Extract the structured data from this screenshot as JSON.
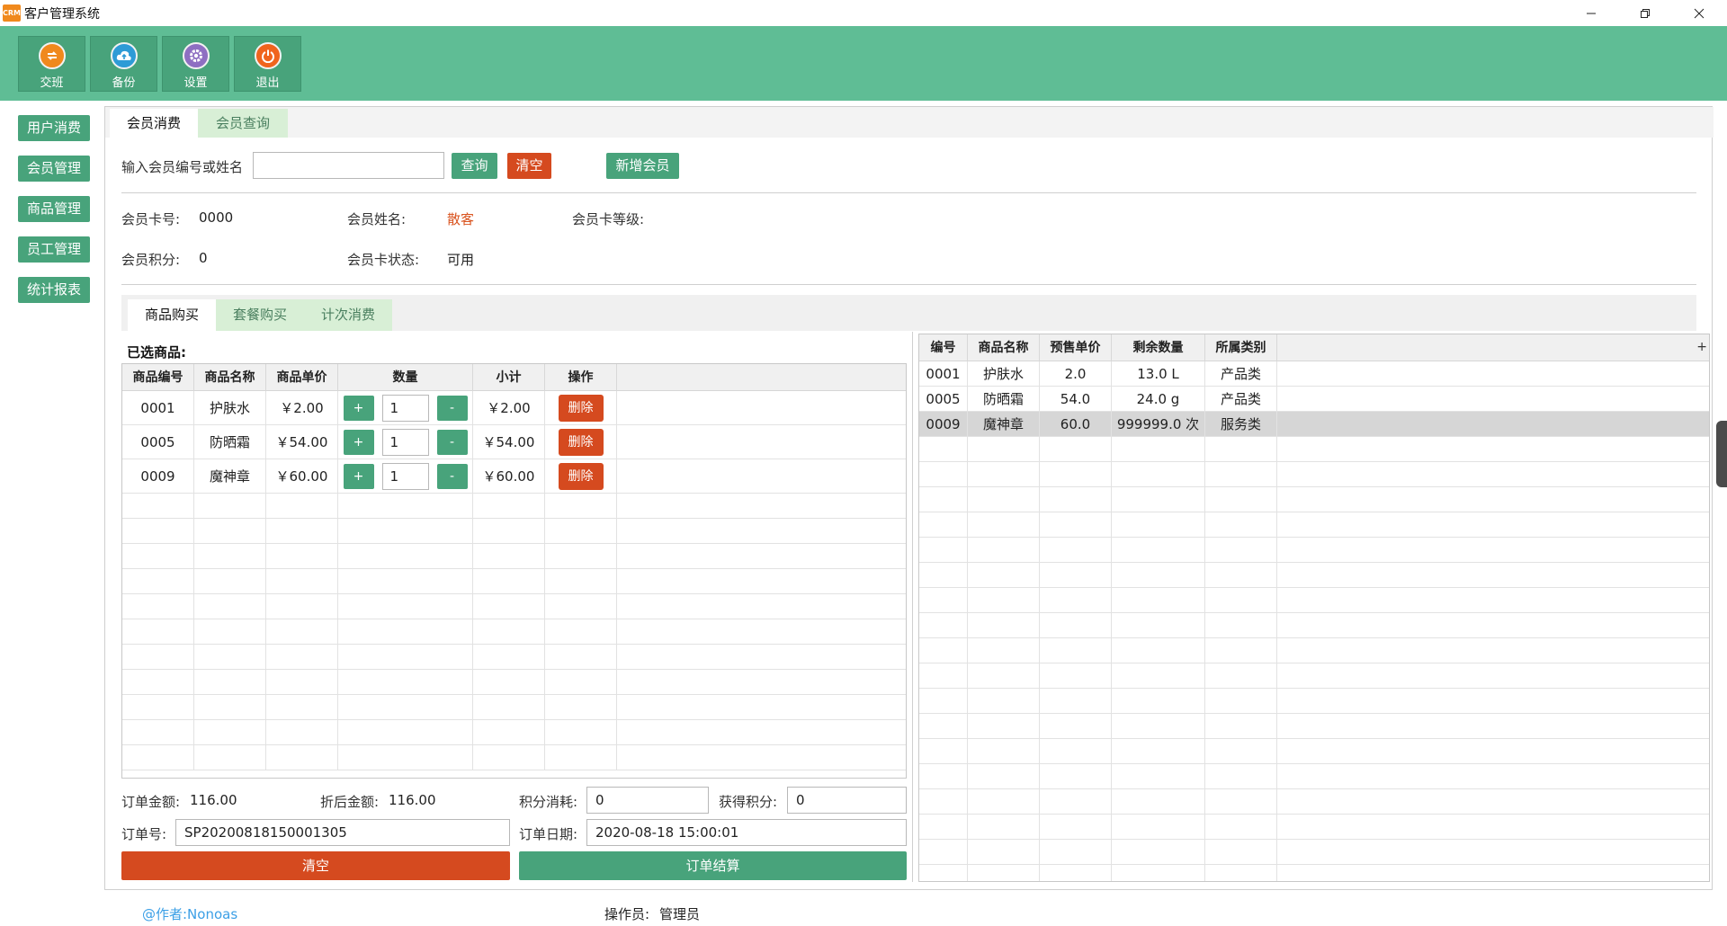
{
  "window": {
    "app_icon_text": "CRM",
    "title": "客户管理系统"
  },
  "toolbar": [
    {
      "label": "交班",
      "icon": "handover-icon",
      "color": "#f0891d"
    },
    {
      "label": "备份",
      "icon": "cloud-upload-icon",
      "color": "#2e9bd6"
    },
    {
      "label": "设置",
      "icon": "gear-icon",
      "color": "#8e6fc2"
    },
    {
      "label": "退出",
      "icon": "power-icon",
      "color": "#f0641d"
    }
  ],
  "sidebar": [
    "用户消费",
    "会员管理",
    "商品管理",
    "员工管理",
    "统计报表"
  ],
  "main_tabs": {
    "consume": "会员消费",
    "query": "会员查询"
  },
  "search": {
    "label": "输入会员编号或姓名",
    "value": "",
    "query_btn": "查询",
    "clear_btn": "清空",
    "add_member_btn": "新增会员"
  },
  "member": {
    "card_no_label": "会员卡号:",
    "card_no": "0000",
    "name_label": "会员姓名:",
    "name": "散客",
    "level_label": "会员卡等级:",
    "level": "",
    "points_label": "会员积分:",
    "points": "0",
    "status_label": "会员卡状态:",
    "status": "可用"
  },
  "sub_tabs": {
    "goods": "商品购买",
    "package": "套餐购买",
    "times": "计次消费"
  },
  "selected_title": "已选商品:",
  "cart": {
    "headers": [
      "商品编号",
      "商品名称",
      "商品单价",
      "数量",
      "小计",
      "操作"
    ],
    "plus": "+",
    "minus": "-",
    "delete": "删除",
    "rows": [
      {
        "code": "0001",
        "name": "护肤水",
        "price": "￥2.00",
        "qty": "1",
        "subtotal": "￥2.00"
      },
      {
        "code": "0005",
        "name": "防晒霜",
        "price": "￥54.00",
        "qty": "1",
        "subtotal": "￥54.00"
      },
      {
        "code": "0009",
        "name": "魔神章",
        "price": "￥60.00",
        "qty": "1",
        "subtotal": "￥60.00"
      }
    ]
  },
  "products": {
    "headers": [
      "编号",
      "商品名称",
      "预售单价",
      "剩余数量",
      "所属类别"
    ],
    "rows": [
      {
        "code": "0001",
        "name": "护肤水",
        "price": "2.0",
        "stock": "13.0 L",
        "category": "产品类"
      },
      {
        "code": "0005",
        "name": "防晒霜",
        "price": "54.0",
        "stock": "24.0 g",
        "category": "产品类"
      },
      {
        "code": "0009",
        "name": "魔神章",
        "price": "60.0",
        "stock": "999999.0 次",
        "category": "服务类"
      }
    ]
  },
  "order": {
    "amount_label": "订单金额:",
    "amount": "116.00",
    "discount_label": "折后金额:",
    "discount": "116.00",
    "points_use_label": "积分消耗:",
    "points_use": "0",
    "points_gain_label": "获得积分:",
    "points_gain": "0",
    "no_label": "订单号:",
    "no": "SP20200818150001305",
    "date_label": "订单日期:",
    "date": "2020-08-18 15:00:01",
    "clear_btn": "清空",
    "checkout_btn": "订单结算"
  },
  "footer": {
    "author": "@作者:Nonoas",
    "operator_label": "操作员:",
    "operator": "管理员"
  }
}
